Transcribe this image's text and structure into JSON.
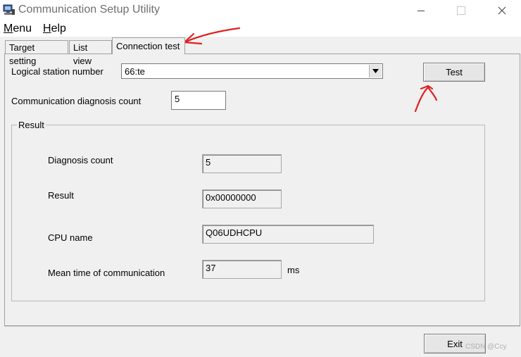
{
  "window": {
    "title": "Communication Setup Utility"
  },
  "menu": [
    {
      "label_prefix": "",
      "underline": "M",
      "rest": "enu"
    },
    {
      "label_prefix": "",
      "underline": "H",
      "rest": "elp"
    }
  ],
  "tabs": [
    "Target setting",
    "List view",
    "Connection test"
  ],
  "active_tab": "Connection test",
  "connection_test": {
    "logical_station_label": "Logical station number",
    "logical_station_value": "66:te",
    "diagnosis_count_label": "Communication diagnosis count",
    "diagnosis_count_value": "5",
    "test_button": "Test",
    "result_group_title": "Result",
    "result": {
      "diagnosis_count_label": "Diagnosis count",
      "diagnosis_count_value": "5",
      "result_label": "Result",
      "result_value": "0x00000000",
      "cpu_name_label": "CPU name",
      "cpu_name_value": "Q06UDHCPU",
      "mean_time_label": "Mean time of communication",
      "mean_time_value": "37",
      "mean_time_unit": "ms"
    }
  },
  "exit_button": "Exit",
  "watermark": "CSDN @Ccy",
  "colors": {
    "annotation": "#e02020",
    "title_text": "#6f6f6f"
  }
}
